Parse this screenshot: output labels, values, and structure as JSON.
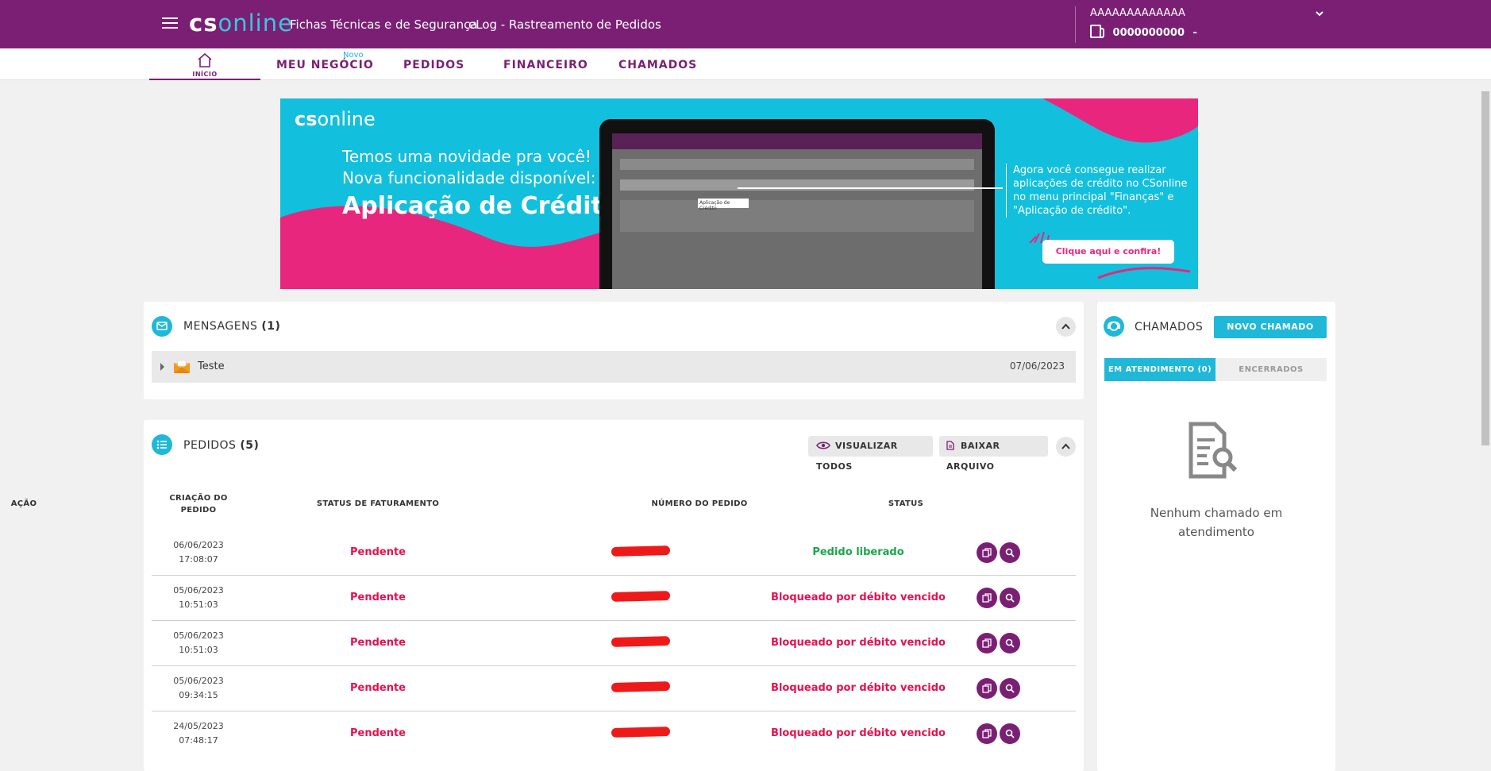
{
  "header": {
    "logo_cs": "cs",
    "logo_online": "online",
    "links": [
      "Fichas Técnicas e de Segurança",
      "eLog - Rastreamento de Pedidos"
    ],
    "user_name": "AAAAAAAAAAAAA",
    "user_code": "0000000000",
    "user_code_suffix": "-"
  },
  "nav": {
    "home_label": "INÍCIO",
    "items": [
      "MEU NEGÓCIO",
      "PEDIDOS",
      "FINANCEIRO",
      "CHAMADOS"
    ],
    "new_badge": "Novo"
  },
  "banner": {
    "logo_cs": "cs",
    "logo_online": "online",
    "line1": "Temos uma novidade pra você!",
    "line2": "Nova funcionalidade disponível:",
    "headline": "Aplicação de Crédito",
    "description": "Agora você consegue realizar aplicações de crédito no CSonline no menu principal \"Finanças\" e \"Aplicação de crédito\".",
    "cta": "Clique aqui e confira!",
    "screen_callout": "Aplicação de Crédito",
    "colors": {
      "bg": "#12c0dd",
      "pink": "#e8267e"
    }
  },
  "messages": {
    "title": "MENSAGENS",
    "count": "(1)",
    "items": [
      {
        "subject": "Teste",
        "date": "07/06/2023"
      }
    ]
  },
  "orders": {
    "title": "PEDIDOS",
    "count": "(5)",
    "view_all": "VISUALIZAR TODOS",
    "download": "BAIXAR ARQUIVO",
    "columns": [
      "CRIAÇÃO DO PEDIDO",
      "STATUS DE FATURAMENTO",
      "NÚMERO DO PEDIDO",
      "STATUS",
      "AÇÃO"
    ],
    "rows": [
      {
        "date": "06/06/2023",
        "time": "17:08:07",
        "billing": "Pendente",
        "status": "Pedido liberado",
        "status_color": "#1aa64a"
      },
      {
        "date": "05/06/2023",
        "time": "10:51:03",
        "billing": "Pendente",
        "status": "Bloqueado por débito vencido",
        "status_color": "#e5114f"
      },
      {
        "date": "05/06/2023",
        "time": "10:51:03",
        "billing": "Pendente",
        "status": "Bloqueado por débito vencido",
        "status_color": "#e5114f"
      },
      {
        "date": "05/06/2023",
        "time": "09:34:15",
        "billing": "Pendente",
        "status": "Bloqueado por débito vencido",
        "status_color": "#e5114f"
      },
      {
        "date": "24/05/2023",
        "time": "07:48:17",
        "billing": "Pendente",
        "status": "Bloqueado por débito vencido",
        "status_color": "#e5114f"
      }
    ]
  },
  "tickets": {
    "title": "CHAMADOS",
    "new_button": "NOVO CHAMADO",
    "tab_active": "EM ATENDIMENTO (0)",
    "tab_inactive": "ENCERRADOS",
    "empty_text": "Nenhum chamado em atendimento"
  },
  "colors": {
    "brand": "#7b1f75",
    "accent": "#1fb8d8",
    "danger": "#e5114f",
    "success": "#1aa64a"
  }
}
